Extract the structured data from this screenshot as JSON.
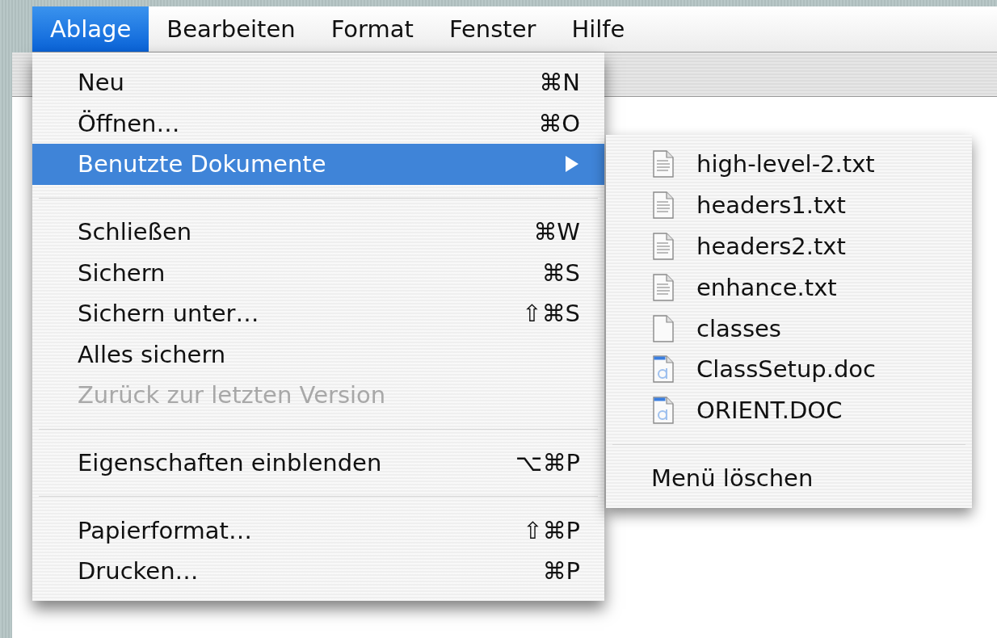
{
  "menubar": [
    {
      "label": "Ablage",
      "selected": true
    },
    {
      "label": "Bearbeiten",
      "selected": false
    },
    {
      "label": "Format",
      "selected": false
    },
    {
      "label": "Fenster",
      "selected": false
    },
    {
      "label": "Hilfe",
      "selected": false
    }
  ],
  "menu": {
    "items": [
      {
        "kind": "item",
        "label": "Neu",
        "shortcut": "⌘N",
        "selected": false,
        "disabled": false
      },
      {
        "kind": "item",
        "label": "Öffnen…",
        "shortcut": "⌘O",
        "selected": false,
        "disabled": false
      },
      {
        "kind": "submenu",
        "label": "Benutzte Dokumente",
        "selected": true,
        "disabled": false
      },
      {
        "kind": "separator"
      },
      {
        "kind": "item",
        "label": "Schließen",
        "shortcut": "⌘W",
        "selected": false,
        "disabled": false
      },
      {
        "kind": "item",
        "label": "Sichern",
        "shortcut": "⌘S",
        "selected": false,
        "disabled": false
      },
      {
        "kind": "item",
        "label": "Sichern unter…",
        "shortcut": "⇧⌘S",
        "selected": false,
        "disabled": false
      },
      {
        "kind": "item",
        "label": "Alles sichern",
        "selected": false,
        "disabled": false
      },
      {
        "kind": "item",
        "label": "Zurück zur letzten Version",
        "selected": false,
        "disabled": true
      },
      {
        "kind": "separator"
      },
      {
        "kind": "item",
        "label": "Eigenschaften einblenden",
        "shortcut": "⌥⌘P",
        "selected": false,
        "disabled": false
      },
      {
        "kind": "separator"
      },
      {
        "kind": "item",
        "label": "Papierformat…",
        "shortcut": "⇧⌘P",
        "selected": false,
        "disabled": false
      },
      {
        "kind": "item",
        "label": "Drucken…",
        "shortcut": "⌘P",
        "selected": false,
        "disabled": false
      }
    ]
  },
  "submenu": {
    "items": [
      {
        "kind": "text-file",
        "label": "high-level-2.txt"
      },
      {
        "kind": "text-file",
        "label": "headers1.txt"
      },
      {
        "kind": "text-file",
        "label": "headers2.txt"
      },
      {
        "kind": "text-file",
        "label": "enhance.txt"
      },
      {
        "kind": "blank-file",
        "label": "classes"
      },
      {
        "kind": "word-file",
        "label": "ClassSetup.doc"
      },
      {
        "kind": "word-file",
        "label": "ORIENT.DOC"
      },
      {
        "kind": "separator"
      },
      {
        "kind": "action",
        "label": "Menü löschen"
      }
    ]
  }
}
